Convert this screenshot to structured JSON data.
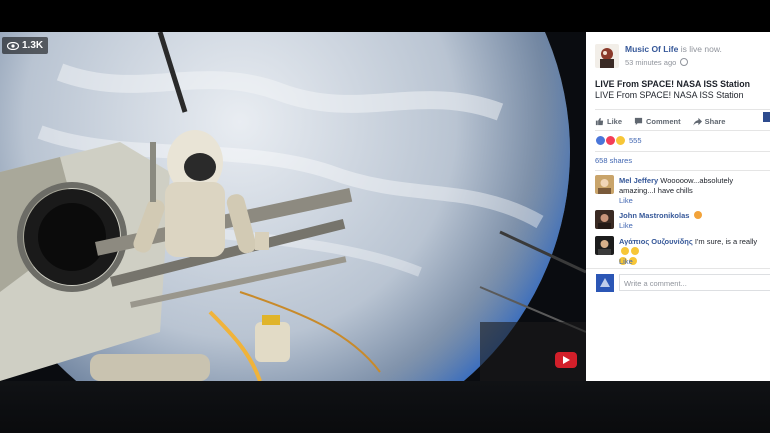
{
  "video": {
    "viewer_count": "1.3K"
  },
  "post": {
    "page_name": "Music Of Life",
    "page_status": "is live now.",
    "time": "53 minutes ago",
    "title": "LIVE From SPACE! NASA ISS Station",
    "description": "LIVE From SPACE! NASA ISS Station"
  },
  "actions": {
    "like": "Like",
    "comment": "Comment",
    "share": "Share"
  },
  "reactions": {
    "count": "555",
    "colors": [
      "#4a76d9",
      "#f33e58",
      "#f7c637"
    ]
  },
  "shares": "658 shares",
  "comments": [
    {
      "author": "Mel Jeffery",
      "text": "Wooooow...absolutely amazing...I have chills",
      "like": "Like"
    },
    {
      "author": "John Mastronikolas",
      "text": "",
      "like": "Like"
    },
    {
      "author": "Αγάπιος Ουζουνίδης",
      "text": "I'm sure, is a really",
      "like": "Like"
    }
  ],
  "composer": {
    "placeholder": "Write a comment..."
  }
}
